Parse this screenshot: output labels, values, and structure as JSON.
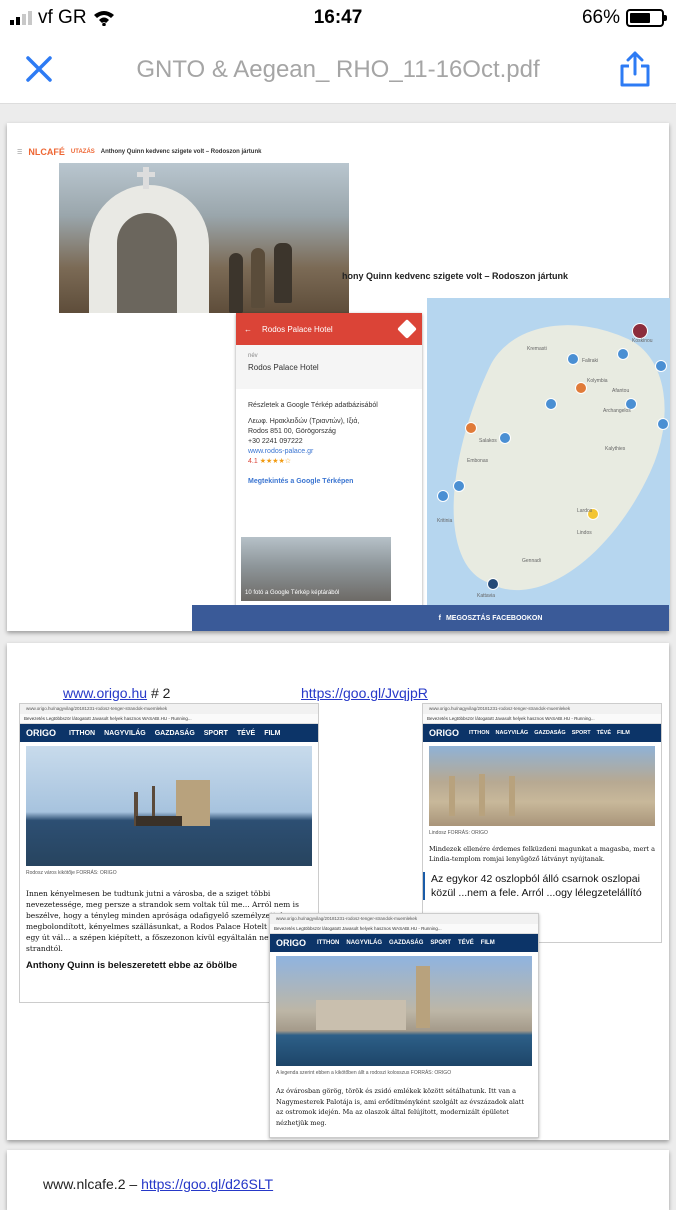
{
  "status_bar": {
    "carrier": "vf GR",
    "time": "16:47",
    "battery": "66%",
    "battery_level": 0.66
  },
  "nav": {
    "title": "GNTO & Aegean_ RHO_11-16Oct.pdf"
  },
  "page1": {
    "logo": "NLCAFÉ",
    "section": "UTAZÁS",
    "header_title": "Anthony Quinn kedvenc szigete volt – Rodoszon jártunk",
    "headline": "hony Quinn kedvenc szigete volt – Rodoszon jártunk",
    "hotel_card": {
      "title": "Rodos Palace Hotel",
      "label": "név",
      "name": "Rodos Palace Hotel",
      "details_header": "Részletek a Google Térkép adatbázisából",
      "address1": "Λεωφ. Ηρακλειδών (Τριαντών), Ιξιά,",
      "address2": "Rodos 851 00, Görögország",
      "phone": "+30 2241 097222",
      "website": "www.rodos-palace.gr",
      "rating": "4.1",
      "stars": "★★★★☆",
      "open_maps": "Megtekintés a Google Térképen",
      "photos": "10 fotó a Google Térkép képtárából"
    },
    "map_labels": [
      "Kolymbia",
      "Archangelos",
      "Kalythies",
      "Lardos",
      "Lindos",
      "Gennadi",
      "Kattavia",
      "Embonas",
      "Faliraki",
      "Afantou",
      "Kritinia",
      "Salakos",
      "Koskinou",
      "Kremasti"
    ],
    "facebook": "MEGOSZTÁS FACEBOOKON"
  },
  "page2": {
    "link1": "www.origo.hu",
    "link1_suffix": "# 2",
    "link2": "https://goo.gl/JvqjpR",
    "browser_url1": "www.origo.hu/nagyvilag/20181231-rodosz-tenger-strandok-muemlekek",
    "browser_url2": "www.origo.hu/nagyvilag/20181231-rodosz-tenger-strandok-muemlekek",
    "browser_url3": "www.origo.hu/nagyvilag/20181231-rodosz-tenger-strandok-muemlekek",
    "bookmarks": "Bevezetés  Legtöbbször látogatott  Javasolt helyek  hasznos  WASABI.HU - Running...",
    "menu": [
      "ORIGO",
      "ITTHON",
      "NAGYVILÁG",
      "GAZDASÁG",
      "SPORT",
      "TÉVÉ",
      "FILM"
    ],
    "caption1": "Rodosz város kikötője FORRÁS: ORIGO",
    "text1": "Innen kényelmesen be tudtunk jutni a városba, de a sziget többi nevezetessége, meg persze a strandok sem voltak túl me... Arról nem is beszélve, hogy a tényleg minden aprósága odafigyelő személyzettel megbolondított, kényelmes szállásunkat, a Rodos Palace Hotelt mindössze egy út vál... a szépen kiépített, a főszezonon kívül egyáltalán nem zs... strandtól.",
    "bold1": "Anthony Quinn is beleszeretett ebbe az öbölbe",
    "caption2": "Lindosz FORRÁS: ORIGO",
    "text2": "Mindezek ellenére érdemes felküzdeni magunkat a magasba, mert a Lindia-templom romjai lenyűgöző látványt nyújtanak.",
    "text3": "Az egykor 42 oszlopból álló csarnok oszlopai közül ...nem a fele. Arról ...ogy lélegzetelállító",
    "caption3": "A legenda szerint ebben a kikötőben állt a rodoszi kolosszus FORRÁS: ORIGO",
    "text4": "Az óvárosban görög, török és zsidó emlékek között sétálhatunk. Itt van a Nagymesterek Palotája is, ami erődítményként szolgált az évszázadok alatt az ostromok idején. Ma az olaszok által felújított, modernizált épületet nézhetjük meg."
  },
  "page3": {
    "text": "www.nlcafe.2 –",
    "link": "https://goo.gl/d26SLT"
  },
  "colors": {
    "accent": "#2d7bf4",
    "nav_title": "#a5a5a5",
    "facebook": "#3a5a98",
    "origo_menu": "#0c3468",
    "map_card_red": "#db4437"
  },
  "icons": {
    "close": "close-icon",
    "share": "share-icon",
    "wifi": "wifi-icon",
    "signal": "signal-icon"
  }
}
